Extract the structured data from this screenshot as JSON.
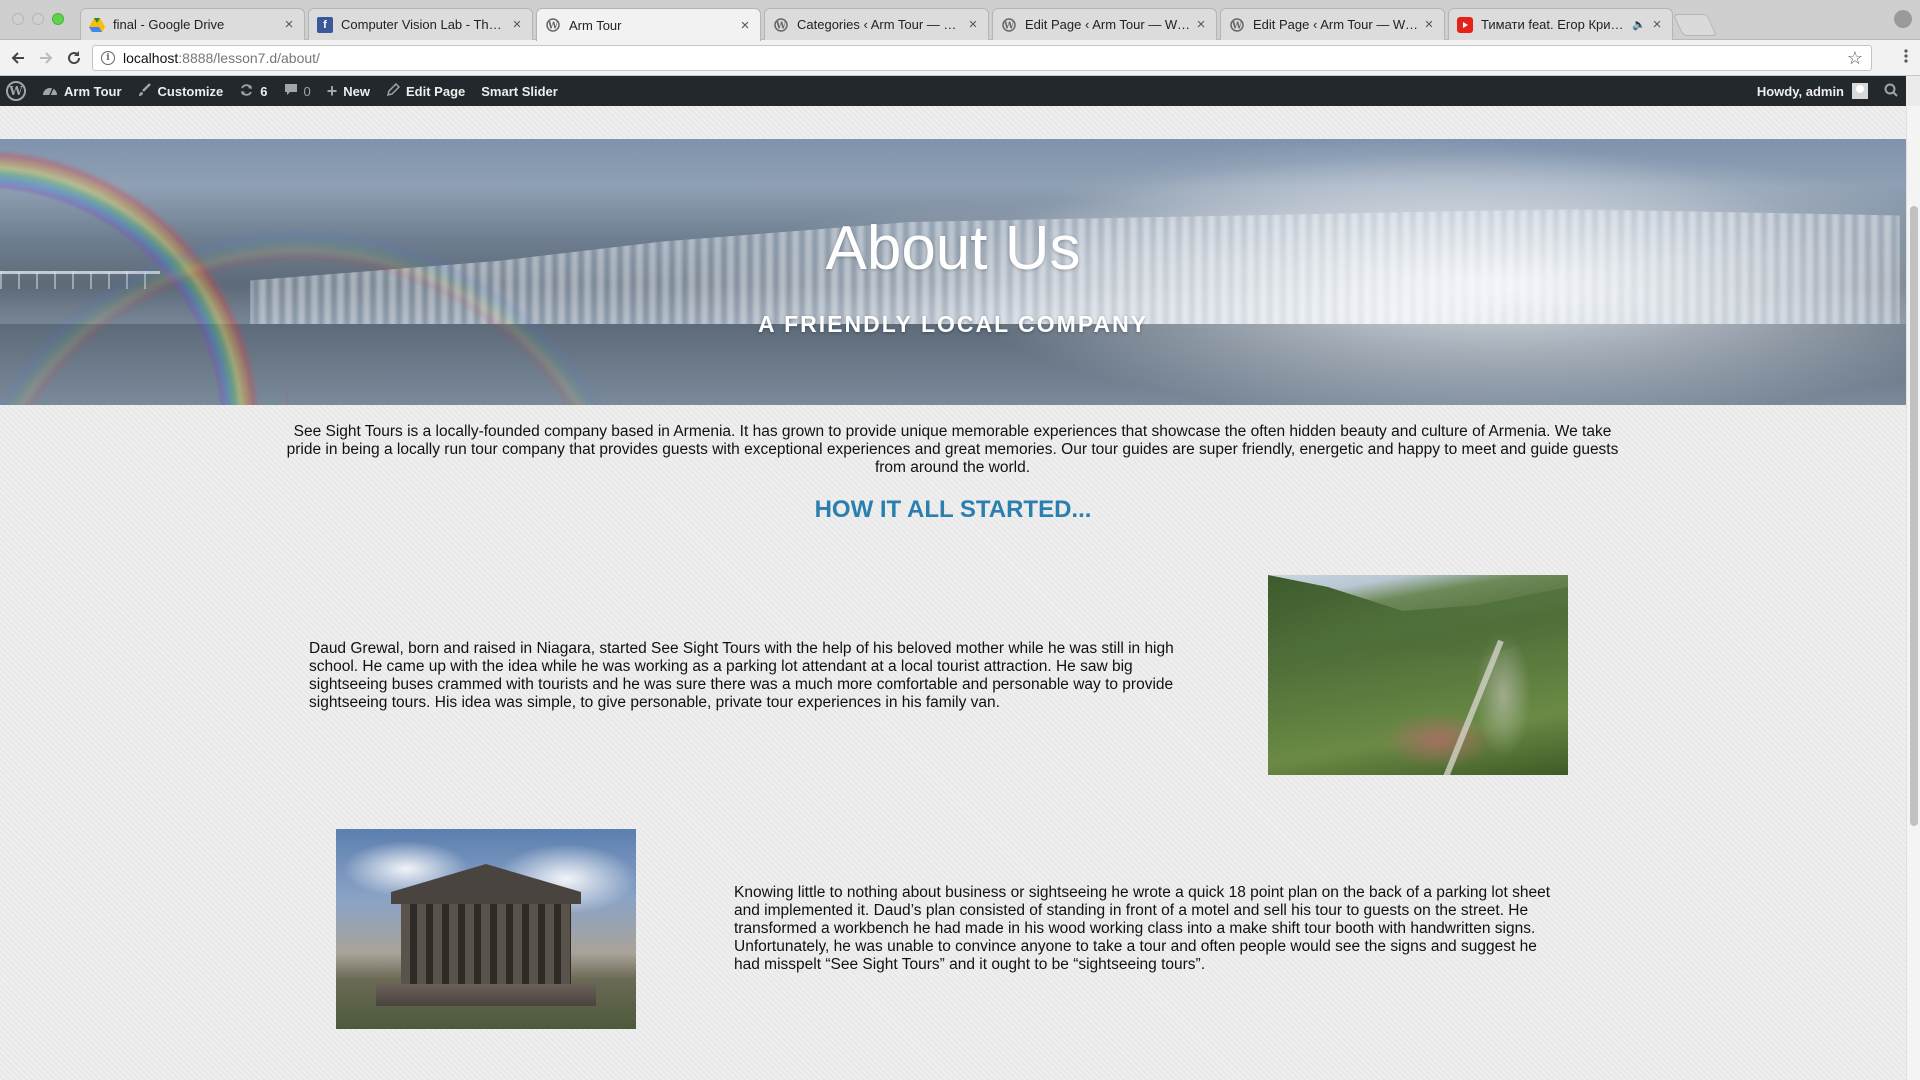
{
  "browser": {
    "tabs": [
      {
        "title": "final - Google Drive",
        "icon": "google-drive-icon",
        "active": false
      },
      {
        "title": "Computer Vision Lab - The Uni",
        "icon": "facebook-icon",
        "active": false
      },
      {
        "title": "Arm Tour",
        "icon": "wordpress-icon",
        "active": true
      },
      {
        "title": "Categories ‹ Arm Tour — Word",
        "icon": "wordpress-icon",
        "active": false
      },
      {
        "title": "Edit Page ‹ Arm Tour — WordP",
        "icon": "wordpress-icon",
        "active": false
      },
      {
        "title": "Edit Page ‹ Arm Tour — WordP",
        "icon": "wordpress-icon",
        "active": false
      },
      {
        "title": "Тимати feat. Егор Крид - П",
        "icon": "youtube-icon",
        "active": false
      }
    ],
    "url_host": "localhost",
    "url_path": ":8888/lesson7.d/about/"
  },
  "adminbar": {
    "site_name": "Arm Tour",
    "customize": "Customize",
    "updates_count": "6",
    "comments_count": "0",
    "new_label": "New",
    "edit_page": "Edit Page",
    "smart_slider": "Smart Slider",
    "howdy": "Howdy, admin"
  },
  "hero": {
    "title": "About Us",
    "subtitle": "A FRIENDLY LOCAL COMPANY"
  },
  "content": {
    "intro": "See Sight Tours is a locally-founded company based in Armenia. It has grown to provide unique memorable experiences that showcase the often hidden beauty and culture of Armenia. We take pride in being a locally run tour company that provides guests with exceptional experiences and great memories. Our tour guides are super friendly, energetic and happy to meet and guide guests from around the world.",
    "heading": "HOW IT ALL STARTED...",
    "story1": "Daud Grewal, born and raised in Niagara, started See Sight Tours with the help of his beloved mother while he was still in high school. He came up with the idea while he was working as a parking lot attendant at a local tourist attraction. He saw big sightseeing buses crammed with tourists and he was sure there was a much more comfortable and personable way to provide sightseeing tours. His idea was simple, to give personable, private tour experiences in his family van.",
    "story2": "Knowing little to nothing about business or sightseeing he wrote a quick 18 point plan on the back of a parking lot sheet and implemented it. Daud’s plan consisted of standing in front of a motel and sell his tour to guests on the street. He transformed a workbench he had made in his wood working class into a make shift tour booth with handwritten signs. Unfortunately, he was unable to convince anyone to take a tour and often people would see the signs and suggest he had misspelt “See Sight Tours” and it ought to be “sightseeing tours”."
  },
  "colors": {
    "admin_bar": "#23282d",
    "heading_accent": "#2a7fae",
    "page_background": "#ececec"
  }
}
